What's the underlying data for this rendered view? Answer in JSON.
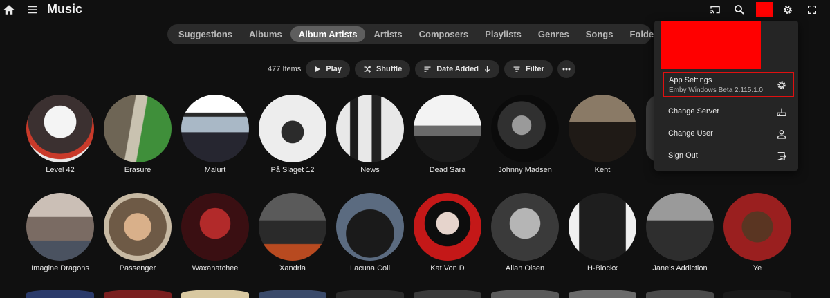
{
  "header": {
    "title": "Music",
    "icons": [
      "home-icon",
      "menu-icon",
      "cast-icon",
      "search-icon",
      "settings-icon",
      "fullscreen-icon"
    ]
  },
  "tabs": [
    {
      "label": "Suggestions"
    },
    {
      "label": "Albums"
    },
    {
      "label": "Album Artists",
      "active": true
    },
    {
      "label": "Artists"
    },
    {
      "label": "Composers"
    },
    {
      "label": "Playlists"
    },
    {
      "label": "Genres"
    },
    {
      "label": "Songs"
    },
    {
      "label": "Folders"
    }
  ],
  "toolbar": {
    "item_count": "477 Items",
    "play_label": "Play",
    "shuffle_label": "Shuffle",
    "sort_label": "Date Added",
    "filter_label": "Filter"
  },
  "artists_row1": [
    {
      "name": "Level 42"
    },
    {
      "name": "Erasure"
    },
    {
      "name": "Malurt"
    },
    {
      "name": "På Slaget 12"
    },
    {
      "name": "News"
    },
    {
      "name": "Dead Sara"
    },
    {
      "name": "Johnny Madsen"
    },
    {
      "name": "Kent"
    }
  ],
  "artists_row2": [
    {
      "name": "Imagine Dragons"
    },
    {
      "name": "Passenger"
    },
    {
      "name": "Waxahatchee"
    },
    {
      "name": "Xandria"
    },
    {
      "name": "Lacuna Coil"
    },
    {
      "name": "Kat Von D"
    },
    {
      "name": "Allan Olsen"
    },
    {
      "name": "H-Blockx"
    },
    {
      "name": "Jane's Addiction"
    },
    {
      "name": "Ye"
    }
  ],
  "user_menu": {
    "app_settings_label": "App Settings",
    "app_version": "Emby Windows Beta 2.115.1.0",
    "change_server_label": "Change Server",
    "change_user_label": "Change User",
    "sign_out_label": "Sign Out"
  },
  "colors": {
    "background": "#101010",
    "accent_highlight": "#e01010",
    "redacted": "#ff0000"
  }
}
